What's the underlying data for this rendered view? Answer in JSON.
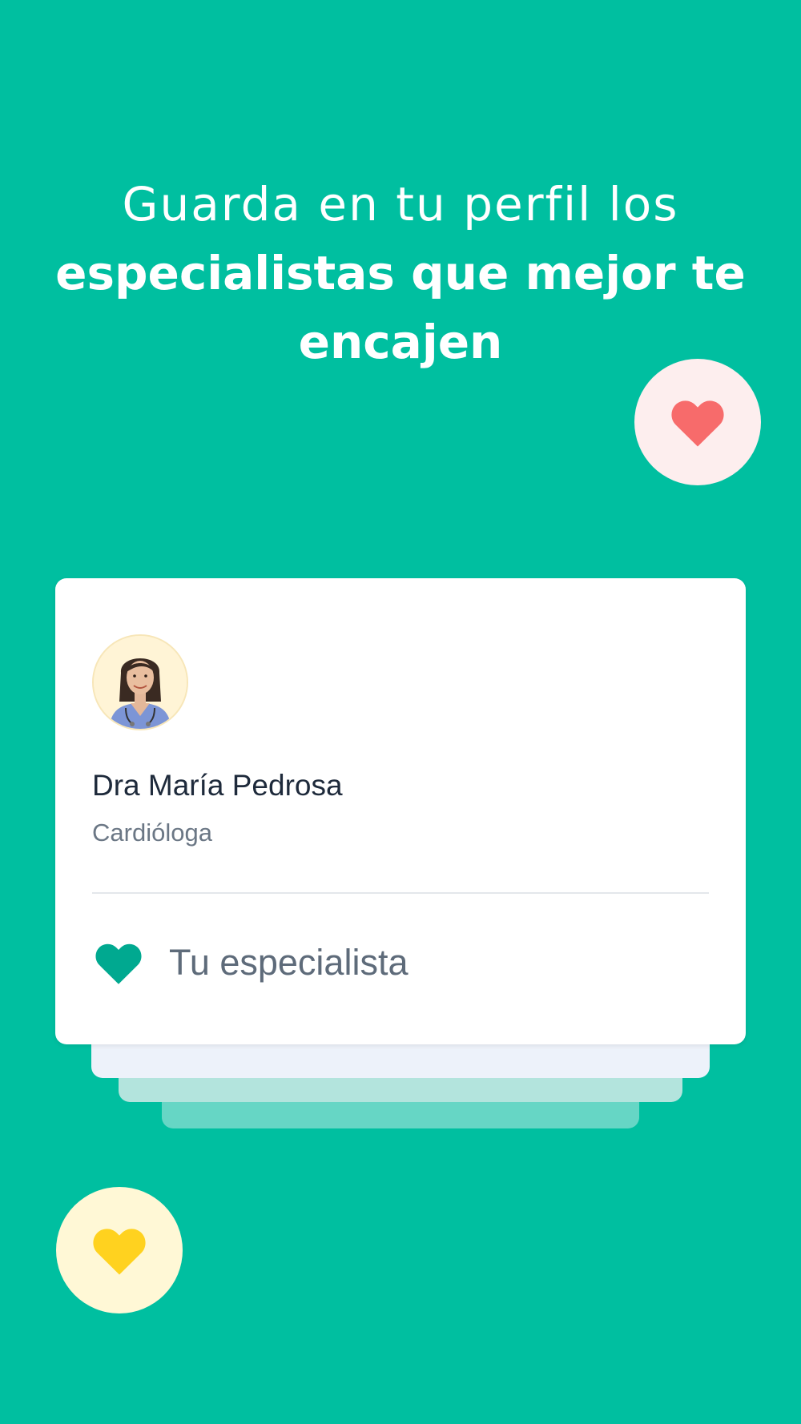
{
  "onboarding": {
    "headline_light": "Guarda en tu perfil los",
    "headline_bold": "especialistas que mejor te encajen"
  },
  "decorations": {
    "top_bubble_icon": "heart-icon",
    "top_bubble_color": "#F76B6B",
    "bottom_bubble_icon": "heart-icon",
    "bottom_bubble_color": "#FFD21F"
  },
  "card": {
    "doctor_name": "Dra María Pedrosa",
    "specialty": "Cardióloga",
    "favorite_label": "Tu especialista",
    "favorite_icon": "heart-icon",
    "favorite_color": "#00A990"
  },
  "colors": {
    "background": "#00BFA0",
    "card": "#FFFFFF",
    "text_primary": "#1E2A3B",
    "text_secondary": "#6B7785"
  }
}
